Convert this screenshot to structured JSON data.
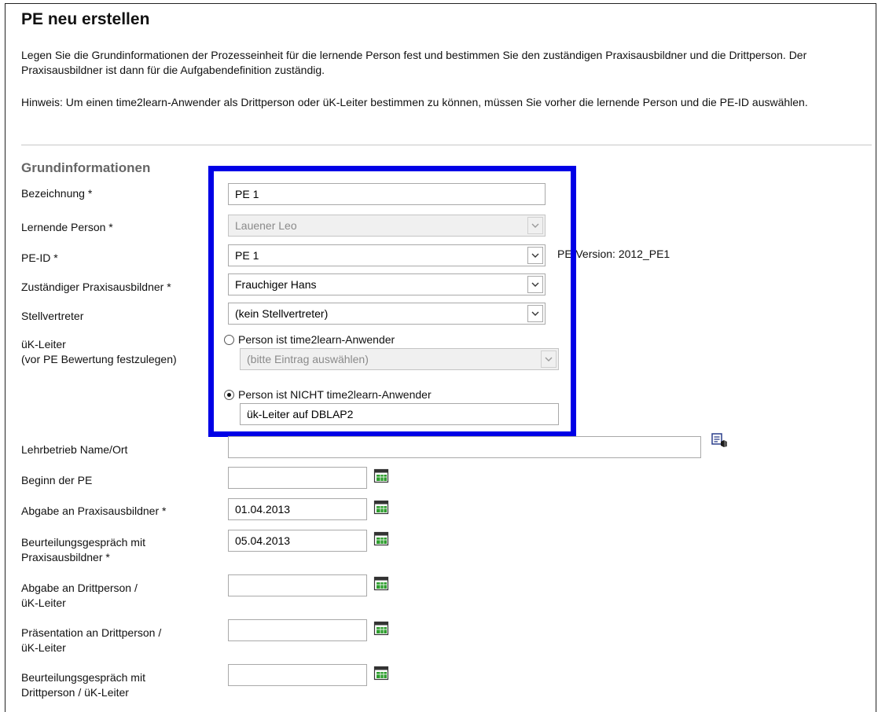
{
  "page": {
    "title": "PE neu erstellen",
    "intro": "Legen Sie die Grundinformationen der Prozesseinheit für die lernende Person fest und bestimmen Sie den zuständigen Praxisausbildner und die Drittperson. Der Praxisausbildner ist dann für die Aufgabendefinition zuständig.",
    "hint": "Hinweis: Um einen time2learn-Anwender als Drittperson oder üK-Leiter bestimmen zu können, müssen Sie vorher die lernende Person und die PE-ID auswählen."
  },
  "section": {
    "title": "Grundinformationen"
  },
  "form": {
    "bezeichnung": {
      "label": "Bezeichnung *",
      "value": "PE 1"
    },
    "lernende": {
      "label": "Lernende Person *",
      "value": "Lauener Leo"
    },
    "peid": {
      "label": "PE-ID *",
      "value": "PE 1",
      "version": "PE-Version: 2012_PE1"
    },
    "praxisausbildner": {
      "label": "Zuständiger Praxisausbildner *",
      "value": "Frauchiger Hans"
    },
    "stellvertreter": {
      "label": "Stellvertreter",
      "value": "(kein Stellvertreter)"
    },
    "uek": {
      "label_1": "üK-Leiter",
      "label_2": "(vor PE Bewertung festzulegen)",
      "option_user": "Person ist time2learn-Anwender",
      "option_user_select": "(bitte Eintrag auswählen)",
      "option_non_user": "Person ist NICHT time2learn-Anwender",
      "non_user_value": "ük-Leiter auf DBLAP2",
      "selected": "non_user"
    },
    "lehrbetrieb": {
      "label": "Lehrbetrieb Name/Ort",
      "value": ""
    },
    "beginn": {
      "label": "Beginn der PE",
      "value": ""
    },
    "abgabe_pa": {
      "label": "Abgabe an Praxisausbildner *",
      "value": "01.04.2013"
    },
    "gespraech_pa": {
      "label_1": "Beurteilungsgespräch mit",
      "label_2": "Praxisausbildner *",
      "value": "05.04.2013"
    },
    "abgabe_dp": {
      "label_1": "Abgabe an Drittperson /",
      "label_2": "üK-Leiter",
      "value": ""
    },
    "praesentation_dp": {
      "label_1": "Präsentation an Drittperson /",
      "label_2": "üK-Leiter",
      "value": ""
    },
    "gespraech_dp": {
      "label_1": "Beurteilungsgespräch mit",
      "label_2": "Drittperson / üK-Leiter",
      "value": ""
    }
  },
  "colors": {
    "highlight": "#0000e6",
    "calendar_green": "#2e9e2e"
  },
  "icons": {
    "calendar": "calendar-icon",
    "lookup": "lookup-icon",
    "dropdown": "chevron-down-icon"
  }
}
